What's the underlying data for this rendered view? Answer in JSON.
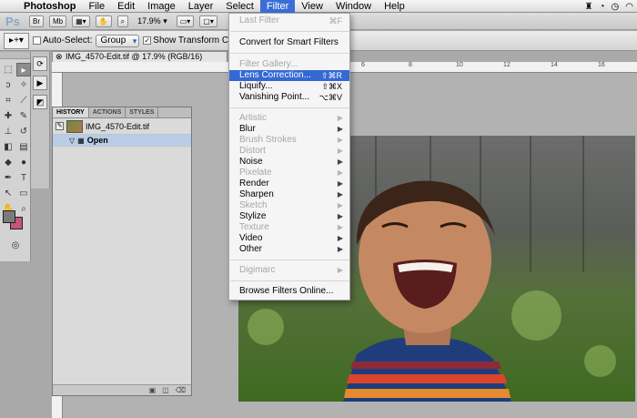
{
  "menubar": {
    "app_name": "Photoshop",
    "items": [
      "File",
      "Edit",
      "Image",
      "Layer",
      "Select",
      "Filter",
      "View",
      "Window",
      "Help"
    ],
    "active": "Filter"
  },
  "appbar": {
    "ps_badge": "Ps",
    "zoom": "17.9%"
  },
  "options": {
    "auto_select_label": "Auto-Select:",
    "auto_select_value": "Group",
    "show_transform_label": "Show Transform Controls"
  },
  "document": {
    "tab_title": "IMG_4570-Edit.tif @ 17.9% (RGB/16)",
    "ruler_marks": [
      "6",
      "8",
      "10",
      "12",
      "14",
      "16"
    ]
  },
  "history": {
    "tabs": [
      "HISTORY",
      "ACTIONS",
      "STYLES"
    ],
    "snapshot": "IMG_4570-Edit.tif",
    "states": [
      "Open"
    ]
  },
  "filter_menu": {
    "last_filter": {
      "label": "Last Filter",
      "shortcut": "⌘F"
    },
    "convert": "Convert for Smart Filters",
    "gallery": "Filter Gallery...",
    "lens": {
      "label": "Lens Correction...",
      "shortcut": "⇧⌘R"
    },
    "liquify": {
      "label": "Liquify...",
      "shortcut": "⇧⌘X"
    },
    "vanishing": {
      "label": "Vanishing Point...",
      "shortcut": "⌥⌘V"
    },
    "submenus": [
      "Artistic",
      "Blur",
      "Brush Strokes",
      "Distort",
      "Noise",
      "Pixelate",
      "Render",
      "Sharpen",
      "Sketch",
      "Stylize",
      "Texture",
      "Video",
      "Other"
    ],
    "digimarc": "Digimarc",
    "browse": "Browse Filters Online..."
  },
  "colors": {
    "menu_highlight": "#3469d4",
    "foreground_swatch": "#7a7a7a",
    "background_swatch": "#c4567a"
  }
}
